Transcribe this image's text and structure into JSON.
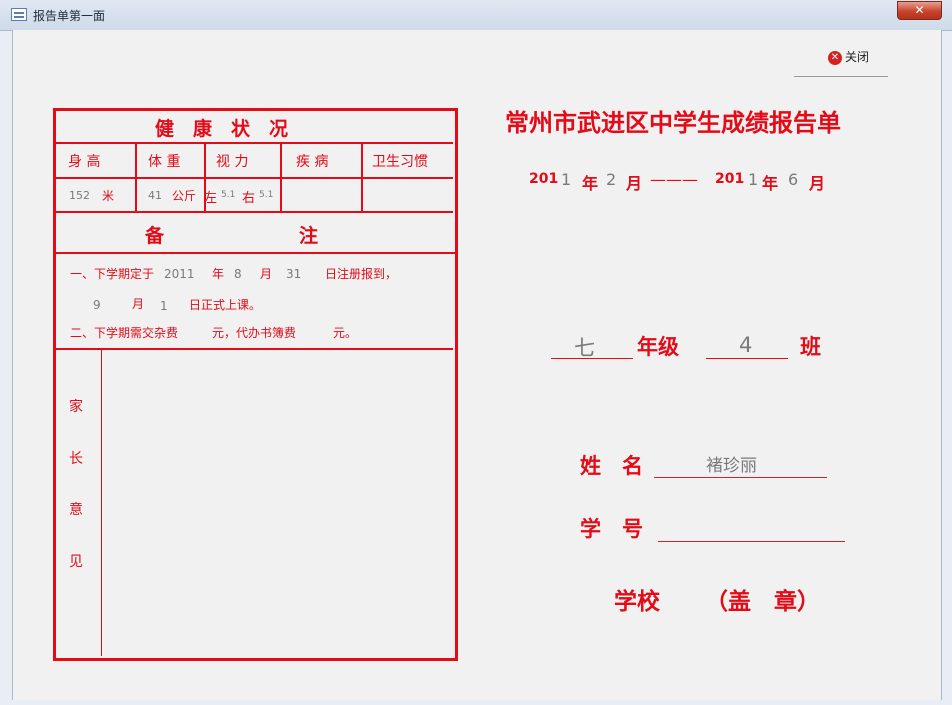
{
  "window": {
    "title": "报告单第一面",
    "close_glyph": "✕"
  },
  "close_button": {
    "label": "关闭"
  },
  "health": {
    "title": "健　康　状　况",
    "headers": {
      "height": "身 高",
      "weight": "体 重",
      "vision": "视 力",
      "disease": "疾 病",
      "hygiene": "卫生习惯"
    },
    "height_value": "152",
    "height_unit": "米",
    "weight_value": "41",
    "weight_unit": "公斤",
    "left_label": "左",
    "left_value": "5.1",
    "right_label": "右",
    "right_value": "5.1"
  },
  "remarks": {
    "title_left": "备",
    "title_right": "注",
    "line1_prefix": "一、下学期定于",
    "year": "2011",
    "year_unit": "年",
    "month": "8",
    "month_unit": "月",
    "day": "31",
    "line1_suffix": "日注册报到，",
    "class_month": "9",
    "class_month_unit": "月",
    "class_day": "1",
    "line2_suffix": "日正式上课。",
    "line3_a": "二、下学期需交杂费",
    "line3_b": "元，代办书簿费",
    "line3_c": "元。"
  },
  "parent": {
    "chars": [
      "家",
      "长",
      "意",
      "见"
    ]
  },
  "report": {
    "title": "常州市武进区中学生成绩报告单",
    "start_prefix": "201",
    "start_digit": "1",
    "year_unit": "年",
    "start_month": "2",
    "month_unit": "月",
    "dash": "———",
    "end_prefix": "201",
    "end_digit": "1",
    "end_month": "6",
    "grade_value": "七",
    "grade_label": "年级",
    "class_value": "4",
    "class_label": "班",
    "name_label": "姓　名",
    "name_value": "褚珍丽",
    "id_label": "学　号",
    "school_label": "学校",
    "seal_label": "（盖　章）"
  }
}
